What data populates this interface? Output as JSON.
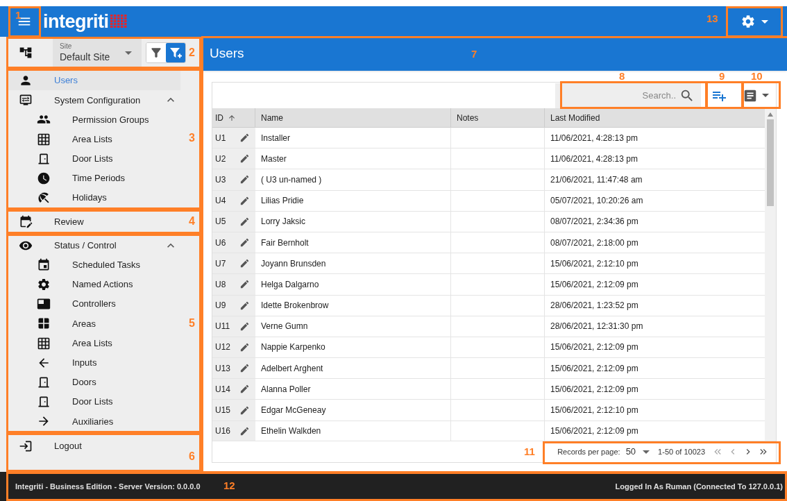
{
  "header": {
    "logo_text": "integriti"
  },
  "sidebar": {
    "site": {
      "label": "Site",
      "value": "Default Site"
    },
    "filters": [
      {
        "selected": false
      },
      {
        "selected": true
      }
    ],
    "sections": [
      {
        "items": [
          {
            "label": "Users",
            "selected": true
          },
          {
            "label": "System Configuration",
            "selected": false,
            "expanded": true,
            "children": [
              {
                "label": "Permission Groups"
              },
              {
                "label": "Area Lists"
              },
              {
                "label": "Door Lists"
              },
              {
                "label": "Time Periods"
              },
              {
                "label": "Holidays"
              }
            ]
          }
        ]
      },
      {
        "items": [
          {
            "label": "Review",
            "selected": false
          }
        ]
      },
      {
        "items": [
          {
            "label": "Status / Control",
            "selected": false,
            "expanded": true,
            "children": [
              {
                "label": "Scheduled Tasks"
              },
              {
                "label": "Named Actions"
              },
              {
                "label": "Controllers"
              },
              {
                "label": "Areas"
              },
              {
                "label": "Area Lists"
              },
              {
                "label": "Inputs"
              },
              {
                "label": "Doors"
              },
              {
                "label": "Door Lists"
              },
              {
                "label": "Auxiliaries"
              }
            ]
          }
        ]
      },
      {
        "items": [
          {
            "label": "Logout",
            "selected": false
          }
        ]
      }
    ]
  },
  "page": {
    "title": "Users",
    "search": {
      "placeholder": "Search.."
    },
    "table": {
      "columns": [
        "ID",
        "Name",
        "Notes",
        "Last Modified"
      ],
      "rows": [
        [
          "U1",
          "Installer",
          "",
          "11/06/2021, 4:28:13 pm"
        ],
        [
          "U2",
          "Master",
          "",
          "11/06/2021, 4:28:13 pm"
        ],
        [
          "U3",
          "( U3 un-named )",
          "",
          "21/06/2021, 11:47:48 am"
        ],
        [
          "U4",
          "Lilias Pridie",
          "",
          "05/07/2021, 10:20:26 am"
        ],
        [
          "U5",
          "Lorry Jaksic",
          "",
          "08/07/2021, 2:34:36 pm"
        ],
        [
          "U6",
          "Fair Bernholt",
          "",
          "08/07/2021, 2:18:00 pm"
        ],
        [
          "U7",
          "Joyann Brunsden",
          "",
          "15/06/2021, 2:12:10 pm"
        ],
        [
          "U8",
          "Helga Dalgarno",
          "",
          "15/06/2021, 2:12:09 pm"
        ],
        [
          "U9",
          "Idette Brokenbrow",
          "",
          "28/06/2021, 1:23:52 pm"
        ],
        [
          "U11",
          "Verne Gumn",
          "",
          "28/06/2021, 12:31:30 pm"
        ],
        [
          "U12",
          "Nappie Karpenko",
          "",
          "15/06/2021, 2:12:09 pm"
        ],
        [
          "U13",
          "Adelbert Arghent",
          "",
          "15/06/2021, 2:12:09 pm"
        ],
        [
          "U14",
          "Alanna Poller",
          "",
          "15/06/2021, 2:12:09 pm"
        ],
        [
          "U15",
          "Edgar McGeneay",
          "",
          "15/06/2021, 2:12:10 pm"
        ],
        [
          "U16",
          "Ethelin Walkden",
          "",
          "15/06/2021, 2:12:09 pm"
        ]
      ]
    },
    "pagination": {
      "label": "Records per page:",
      "per_page": "50",
      "range": "1-50 of 10023"
    }
  },
  "footer": {
    "left": "Integriti - Business Edition - Server Version: 0.0.0.0",
    "right": "Logged In As Ruman (Connected To 127.0.0.1)"
  },
  "annotations": [
    "1",
    "2",
    "3",
    "4",
    "5",
    "6",
    "7",
    "8",
    "9",
    "10",
    "11",
    "12",
    "13"
  ]
}
